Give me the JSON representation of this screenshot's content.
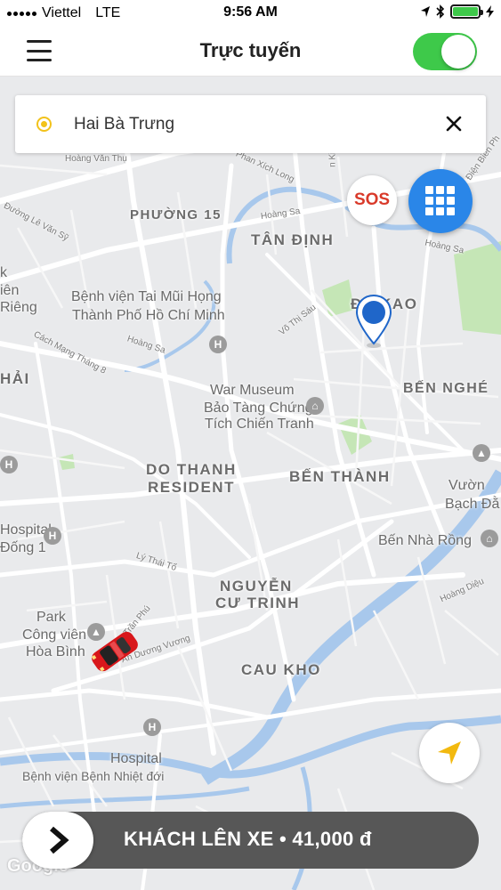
{
  "status_bar": {
    "carrier": "Viettel",
    "network": "LTE",
    "time": "9:56 AM",
    "battery_fill_percent": 100
  },
  "header": {
    "title": "Trực tuyến",
    "online_toggle": true
  },
  "search": {
    "value": "Hai Bà Trưng",
    "clear_icon": "close-icon"
  },
  "map": {
    "districts": [
      "PHƯỜNG 15",
      "TÂN ĐỊNH",
      "ĐA KAO",
      "BẾN NGHÉ",
      "DO THANH",
      "RESIDENT",
      "BẾN THÀNH",
      "NGUYỄN",
      "CƯ TRINH",
      "CAU KHO",
      "HẢI"
    ],
    "places": [
      "Bệnh viện Tai Mũi Họng",
      "Thành Phố Hồ Chí Minh",
      "War Museum",
      "Bảo Tàng Chứng",
      "Tích Chiến Tranh",
      "Vườn",
      "Bạch Đằ",
      "Bến Nhà Rồng",
      "Hospital",
      "Đống 1",
      "Park",
      "Công viên",
      "Hòa Bình",
      "Hospital",
      "Bệnh viện Bệnh Nhiệt đới",
      "k",
      "iên",
      "Riêng"
    ],
    "streets": [
      "Hoàng Văn Thụ",
      "Phan Xích Long",
      "Đường Lê Văn Sỹ",
      "Hoàng Sa",
      "Hoàng Sa",
      "Cách Mạng Tháng 8",
      "Hoàng Sa",
      "Võ Thị Sáu",
      "Lý Thái Tổ",
      "Trần Phú",
      "An Dương Vương",
      "Hoàng Diệu",
      "Điện Biên Ph",
      "n Kiệp"
    ],
    "water_color": "#a8c8ec",
    "park_color": "#c5e6b6",
    "road_color": "#ffffff",
    "pin_color": "#1f66c9",
    "car_color": "#d8171b"
  },
  "buttons": {
    "sos": "SOS",
    "menu_grid_icon": "grid-icon",
    "locate_icon": "navigation-arrow-icon"
  },
  "action": {
    "label": "KHÁCH LÊN XE • 41,000 đ",
    "icon": "chevron-right-icon"
  },
  "attribution": "Google"
}
